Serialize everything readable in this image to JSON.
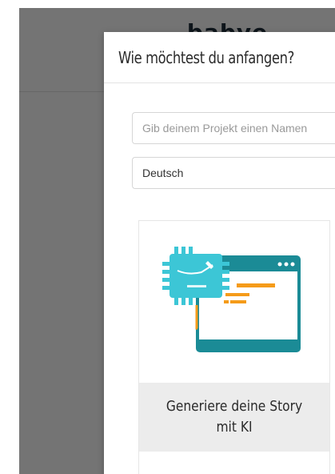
{
  "app": {
    "logo_text": "...babye"
  },
  "modal": {
    "title": "Wie möchtest du anfangen?",
    "name_input": {
      "value": "",
      "placeholder": "Gib deinem Projekt einen Namen"
    },
    "language_select": {
      "selected": "Deutsch"
    },
    "option_card": {
      "label": "Generiere deine Story mit KI",
      "icon": "ai-chip-window-icon"
    }
  },
  "colors": {
    "chip": "#3cc6d6",
    "window_frame": "#1b8b96",
    "accent_orange": "#f59b19",
    "overlay": "#7a7a7a"
  }
}
